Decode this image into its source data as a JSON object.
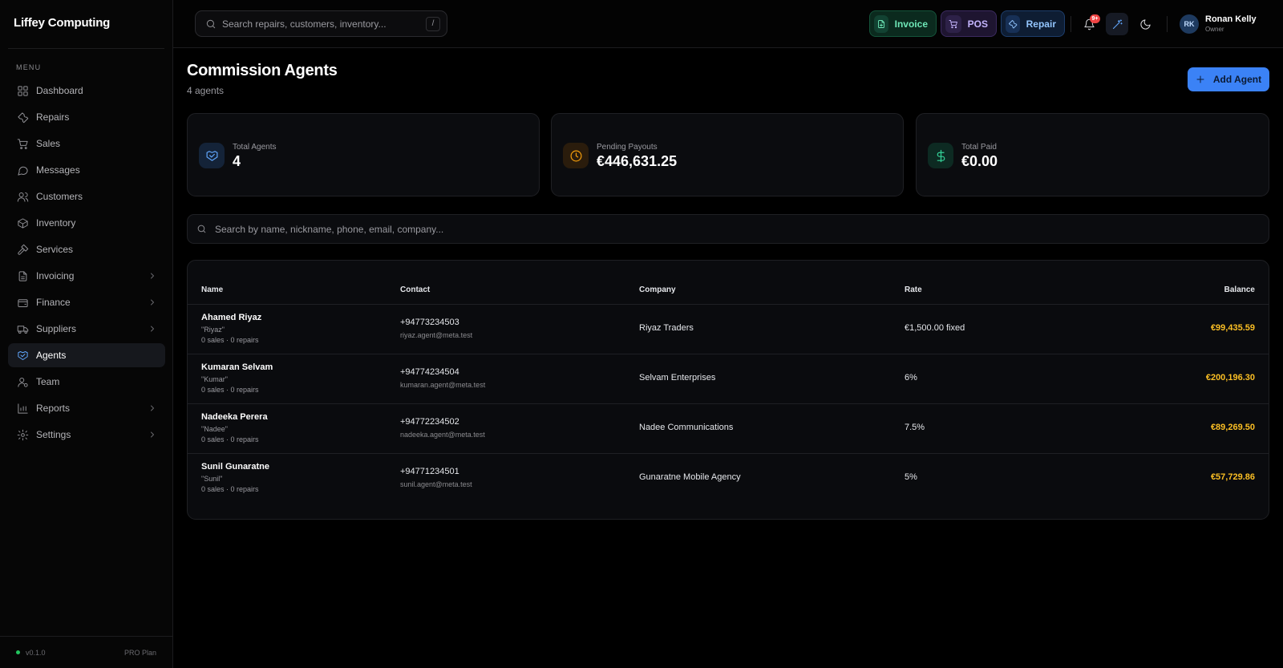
{
  "app": {
    "brand": "Liffey Computing"
  },
  "sidebar": {
    "menu_label": "MENU",
    "items": [
      {
        "label": "Dashboard",
        "icon": "dashboard-icon",
        "active": false,
        "expandable": false
      },
      {
        "label": "Repairs",
        "icon": "wrench-icon",
        "active": false,
        "expandable": false
      },
      {
        "label": "Sales",
        "icon": "cart-icon",
        "active": false,
        "expandable": false
      },
      {
        "label": "Messages",
        "icon": "message-icon",
        "active": false,
        "expandable": false
      },
      {
        "label": "Customers",
        "icon": "users-icon",
        "active": false,
        "expandable": false
      },
      {
        "label": "Inventory",
        "icon": "box-icon",
        "active": false,
        "expandable": false
      },
      {
        "label": "Services",
        "icon": "hammer-icon",
        "active": false,
        "expandable": false
      },
      {
        "label": "Invoicing",
        "icon": "document-icon",
        "active": false,
        "expandable": true
      },
      {
        "label": "Finance",
        "icon": "wallet-icon",
        "active": false,
        "expandable": true
      },
      {
        "label": "Suppliers",
        "icon": "truck-icon",
        "active": false,
        "expandable": true
      },
      {
        "label": "Agents",
        "icon": "handshake-icon",
        "active": true,
        "expandable": false
      },
      {
        "label": "Team",
        "icon": "user-gear-icon",
        "active": false,
        "expandable": false
      },
      {
        "label": "Reports",
        "icon": "bar-chart-icon",
        "active": false,
        "expandable": true
      },
      {
        "label": "Settings",
        "icon": "gear-icon",
        "active": false,
        "expandable": true
      }
    ],
    "footer": {
      "version": "v0.1.0",
      "plan": "PRO Plan"
    }
  },
  "topbar": {
    "search_placeholder": "Search repairs, customers, inventory...",
    "search_shortcut": "/",
    "quick_actions": [
      {
        "label": "Invoice",
        "icon": "file-plus-icon"
      },
      {
        "label": "POS",
        "icon": "cart-icon"
      },
      {
        "label": "Repair",
        "icon": "wrench-icon"
      }
    ],
    "notifications_badge": "9+",
    "user": {
      "initials": "RK",
      "name": "Ronan Kelly",
      "role": "Owner"
    }
  },
  "page": {
    "title": "Commission Agents",
    "subtitle": "4 agents",
    "add_button": "Add Agent"
  },
  "stats": [
    {
      "label": "Total Agents",
      "value": "4",
      "icon": "handshake-icon"
    },
    {
      "label": "Pending Payouts",
      "value": "€446,631.25",
      "icon": "clock-icon"
    },
    {
      "label": "Total Paid",
      "value": "€0.00",
      "icon": "dollar-icon"
    }
  ],
  "filter": {
    "placeholder": "Search by name, nickname, phone, email, company..."
  },
  "colors": {
    "accent": "#3b82f6",
    "balance": "#fbbf24",
    "background": "#000000"
  },
  "table": {
    "headers": {
      "name": "Name",
      "contact": "Contact",
      "company": "Company",
      "rate": "Rate",
      "balance": "Balance"
    },
    "rows": [
      {
        "name": "Ahamed Riyaz",
        "nickname": "\"Riyaz\"",
        "stats": "0 sales · 0 repairs",
        "phone": "+94773234503",
        "email": "riyaz.agent@meta.test",
        "company": "Riyaz Traders",
        "rate": "€1,500.00 fixed",
        "balance": "€99,435.59"
      },
      {
        "name": "Kumaran Selvam",
        "nickname": "\"Kumar\"",
        "stats": "0 sales · 0 repairs",
        "phone": "+94774234504",
        "email": "kumaran.agent@meta.test",
        "company": "Selvam Enterprises",
        "rate": "6%",
        "balance": "€200,196.30"
      },
      {
        "name": "Nadeeka Perera",
        "nickname": "\"Nadee\"",
        "stats": "0 sales · 0 repairs",
        "phone": "+94772234502",
        "email": "nadeeka.agent@meta.test",
        "company": "Nadee Communications",
        "rate": "7.5%",
        "balance": "€89,269.50"
      },
      {
        "name": "Sunil Gunaratne",
        "nickname": "\"Sunil\"",
        "stats": "0 sales · 0 repairs",
        "phone": "+94771234501",
        "email": "sunil.agent@meta.test",
        "company": "Gunaratne Mobile Agency",
        "rate": "5%",
        "balance": "€57,729.86"
      }
    ]
  }
}
